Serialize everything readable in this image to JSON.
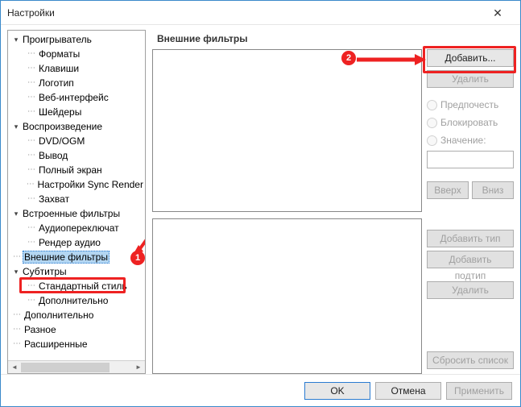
{
  "window": {
    "title": "Настройки"
  },
  "tree": {
    "items": [
      {
        "level": 0,
        "expander": "v",
        "label": "Проигрыватель"
      },
      {
        "level": 1,
        "expander": "",
        "label": "Форматы"
      },
      {
        "level": 1,
        "expander": "",
        "label": "Клавиши"
      },
      {
        "level": 1,
        "expander": "",
        "label": "Логотип"
      },
      {
        "level": 1,
        "expander": "",
        "label": "Веб-интерфейс"
      },
      {
        "level": 1,
        "expander": "",
        "label": "Шейдеры"
      },
      {
        "level": 0,
        "expander": "v",
        "label": "Воспроизведение"
      },
      {
        "level": 1,
        "expander": "",
        "label": "DVD/OGM"
      },
      {
        "level": 1,
        "expander": "",
        "label": "Вывод"
      },
      {
        "level": 1,
        "expander": "",
        "label": "Полный экран"
      },
      {
        "level": 1,
        "expander": "",
        "label": "Настройки Sync Render"
      },
      {
        "level": 1,
        "expander": "",
        "label": "Захват"
      },
      {
        "level": 0,
        "expander": "v",
        "label": "Встроенные фильтры"
      },
      {
        "level": 1,
        "expander": "",
        "label": "Аудиопереключат"
      },
      {
        "level": 1,
        "expander": "",
        "label": "Рендер аудио"
      },
      {
        "level": 0,
        "expander": "",
        "label": "Внешние фильтры",
        "selected": true
      },
      {
        "level": 0,
        "expander": "v",
        "label": "Субтитры"
      },
      {
        "level": 1,
        "expander": "",
        "label": "Стандартный стиль"
      },
      {
        "level": 1,
        "expander": "",
        "label": "Дополнительно"
      },
      {
        "level": 0,
        "expander": "",
        "label": "Дополнительно"
      },
      {
        "level": 0,
        "expander": "",
        "label": "Разное"
      },
      {
        "level": 0,
        "expander": "",
        "label": "Расширенные"
      }
    ]
  },
  "panel": {
    "title": "Внешние фильтры",
    "add": "Добавить...",
    "delete": "Удалить",
    "radio_prefer": "Предпочесть",
    "radio_block": "Блокировать",
    "radio_value": "Значение:",
    "up": "Вверх",
    "down": "Вниз",
    "add_type": "Добавить тип",
    "add_subtype": "Добавить подтип",
    "delete2": "Удалить",
    "reset": "Сбросить список"
  },
  "footer": {
    "ok": "OK",
    "cancel": "Отмена",
    "apply": "Применить"
  },
  "annotations": {
    "step1": "1",
    "step2": "2"
  }
}
